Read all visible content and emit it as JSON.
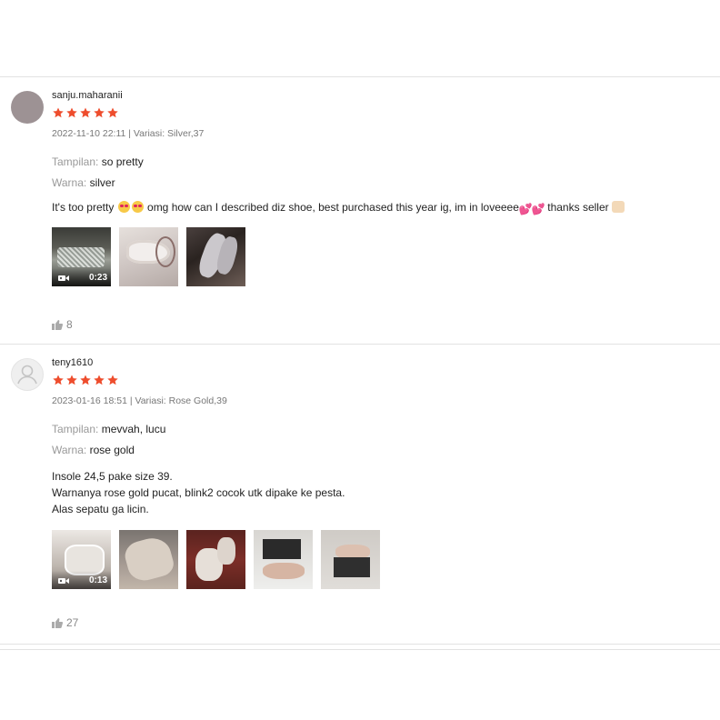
{
  "reviews": [
    {
      "username": "sanju.maharanii",
      "rating": 5,
      "meta": "2022-11-10 22:11 | Variasi: Silver,37",
      "attributes": [
        {
          "label": "Tampilan:",
          "value": "so pretty"
        },
        {
          "label": "Warna:",
          "value": "silver"
        }
      ],
      "text_parts": [
        "It's too pretty",
        "omg how can I described diz shoe, best purchased this year ig, im in loveeee",
        "thanks seller"
      ],
      "media": [
        {
          "type": "video",
          "duration": "0:23"
        },
        {
          "type": "image"
        },
        {
          "type": "image"
        }
      ],
      "likes": "8"
    },
    {
      "username": "teny1610",
      "rating": 5,
      "meta": "2023-01-16 18:51 | Variasi: Rose Gold,39",
      "attributes": [
        {
          "label": "Tampilan:",
          "value": "mevvah, lucu"
        },
        {
          "label": "Warna:",
          "value": "rose gold"
        }
      ],
      "text_lines": [
        "Insole 24,5 pake size 39.",
        "Warnanya rose gold pucat, blink2 cocok utk dipake ke pesta.",
        "Alas sepatu ga licin."
      ],
      "media": [
        {
          "type": "video",
          "duration": "0:13"
        },
        {
          "type": "image"
        },
        {
          "type": "image"
        },
        {
          "type": "image"
        },
        {
          "type": "image"
        }
      ],
      "likes": "27"
    }
  ],
  "colors": {
    "star": "#ee4d2d",
    "divider": "#e2e2e2",
    "muted": "#999999"
  },
  "icons": {
    "star": "star-icon",
    "like": "thumbs-up-icon",
    "video": "video-camera-icon",
    "avatar_default": "user-icon"
  }
}
